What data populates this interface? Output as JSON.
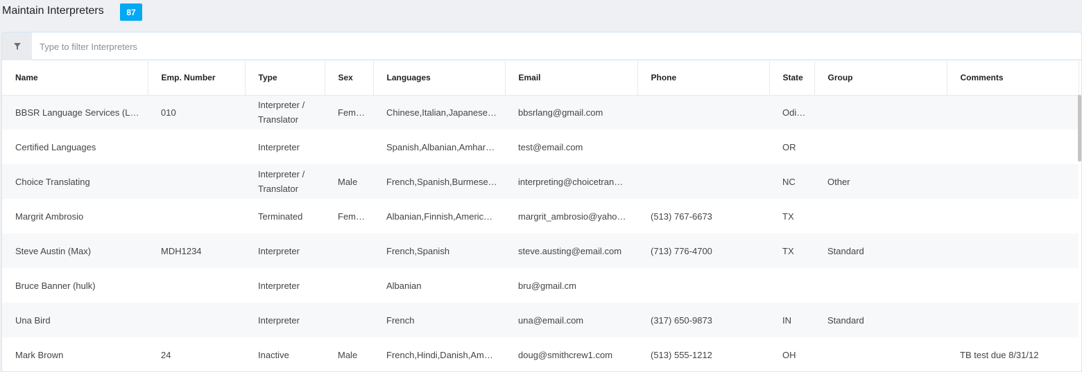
{
  "header": {
    "title": "Maintain Interpreters",
    "count": "87"
  },
  "filter": {
    "placeholder": "Type to filter Interpreters",
    "icon": "filter-icon"
  },
  "columns": [
    "Name",
    "Emp. Number",
    "Type",
    "Sex",
    "Languages",
    "Email",
    "Phone",
    "State",
    "Group",
    "Comments"
  ],
  "rows": [
    {
      "name": "BBSR Language Services (L…",
      "emp": "010",
      "type": "Interpreter / Translator",
      "sex": "Female",
      "languages": "Chinese,Italian,Japanese…",
      "email": "bbsrlang@gmail.com",
      "phone": "",
      "state": "Odisha",
      "group": "",
      "comments": ""
    },
    {
      "name": "Certified Languages",
      "emp": "",
      "type": "Interpreter",
      "sex": "",
      "languages": "Spanish,Albanian,Amhar…",
      "email": "test@email.com",
      "phone": "",
      "state": "OR",
      "group": "",
      "comments": ""
    },
    {
      "name": "Choice Translating",
      "emp": "",
      "type": "Interpreter / Translator",
      "sex": "Male",
      "languages": "French,Spanish,Burmese…",
      "email": "interpreting@choicetran…",
      "phone": "",
      "state": "NC",
      "group": "Other",
      "comments": ""
    },
    {
      "name": "Margrit Ambrosio",
      "emp": "",
      "type": "Terminated",
      "sex": "Female",
      "languages": "Albanian,Finnish,Americ…",
      "email": "margrit_ambrosio@yaho…",
      "phone": "(513) 767-6673",
      "state": "TX",
      "group": "",
      "comments": ""
    },
    {
      "name": "Steve Austin (Max)",
      "emp": "MDH1234",
      "type": "Interpreter",
      "sex": "",
      "languages": "French,Spanish",
      "email": "steve.austing@email.com",
      "phone": "(713) 776-4700",
      "state": "TX",
      "group": "Standard",
      "comments": ""
    },
    {
      "name": "Bruce Banner (hulk)",
      "emp": "",
      "type": "Interpreter",
      "sex": "",
      "languages": "Albanian",
      "email": "bru@gmail.cm",
      "phone": "",
      "state": "",
      "group": "",
      "comments": ""
    },
    {
      "name": "Una Bird",
      "emp": "",
      "type": "Interpreter",
      "sex": "",
      "languages": "French",
      "email": "una@email.com",
      "phone": "(317) 650-9873",
      "state": "IN",
      "group": "Standard",
      "comments": ""
    },
    {
      "name": "Mark Brown",
      "emp": "24",
      "type": "Inactive",
      "sex": "Male",
      "languages": "French,Hindi,Danish,Am…",
      "email": "doug@smithcrew1.com",
      "phone": "(513) 555-1212",
      "state": "OH",
      "group": "",
      "comments": "TB test due 8/31/12"
    }
  ],
  "colors": {
    "accent": "#03a9f4",
    "row_alt": "#f7f8fa",
    "page_bg": "#eef0f3"
  }
}
